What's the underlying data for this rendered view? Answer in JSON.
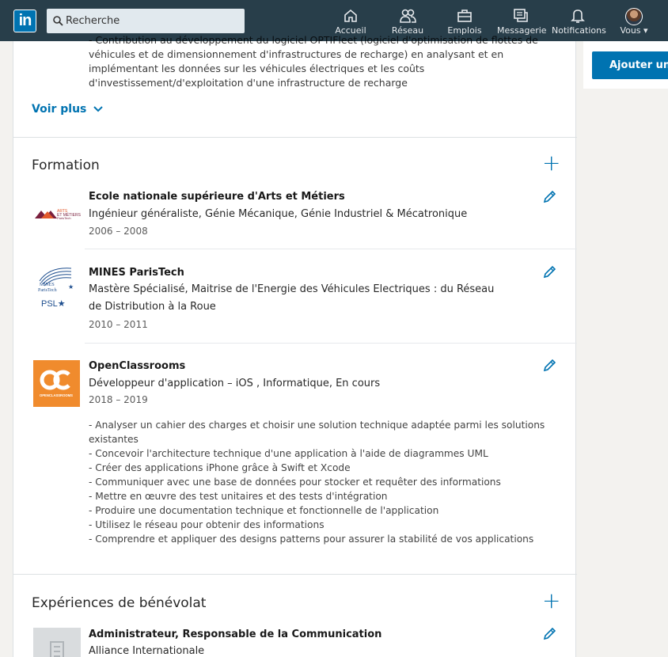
{
  "nav": {
    "search_placeholder": "Recherche",
    "items": [
      {
        "label": "Accueil",
        "icon": "home-icon"
      },
      {
        "label": "Réseau",
        "icon": "network-icon"
      },
      {
        "label": "Emplois",
        "icon": "jobs-icon"
      },
      {
        "label": "Messagerie",
        "icon": "messaging-icon"
      },
      {
        "label": "Notifications",
        "icon": "bell-icon"
      },
      {
        "label": "Vous ▾",
        "icon": "avatar"
      }
    ]
  },
  "experience_tail": {
    "lines": [
      "- Contribution au développement du logiciel OPTIFleet (logiciel d'optimisation de flottes de",
      "véhicules et de dimensionnement d'infrastructures de recharge) en analysant et en",
      "implémentant les données sur les véhicules électriques et les coûts",
      "d'investissement/d'exploitation d'une infrastructure de recharge"
    ],
    "voir_plus": "Voir plus"
  },
  "formation": {
    "title": "Formation",
    "entries": [
      {
        "school": "Ecole nationale supérieure d'Arts et Métiers",
        "degree": "Ingénieur généraliste, Génie Mécanique, Génie Industriel & Mécatronique",
        "dates": "2006 – 2008",
        "logo_text": "ARTS ET MÉTIERS ParisTech"
      },
      {
        "school": "MINES ParisTech",
        "degree": "Mastère Spécialisé, Maitrise de l'Energie des Véhicules Electriques : du Réseau de Distribution à la Roue",
        "dates": "2010 – 2011",
        "logo_text": "MINES ParisTech",
        "logo_sub": "PSL★"
      },
      {
        "school": "OpenClassrooms",
        "degree": "Développeur d'application – iOS , Informatique, En cours",
        "dates": "2018 – 2019",
        "logo_text": "OPENCLASSROOMS",
        "description": [
          "- Analyser un cahier des charges et choisir une solution technique adaptée parmi les solutions",
          "existantes",
          "- Concevoir l'architecture technique d'une application à l'aide de diagrammes UML",
          "- Créer des applications iPhone grâce à Swift et Xcode",
          "- Communiquer avec une base de données pour stocker et requêter des informations",
          "- Mettre en œuvre des test unitaires et des tests d'intégration",
          "- Produire une documentation technique et fonctionnelle de l'application",
          "- Utilisez le réseau pour obtenir des informations",
          "- Comprendre et appliquer des designs patterns pour assurer la stabilité de vos applications"
        ]
      }
    ]
  },
  "benevolat": {
    "title": "Expériences de bénévolat",
    "entries": [
      {
        "role": "Administrateur, Responsable de la Communication",
        "org": "Alliance Internationale"
      }
    ]
  },
  "right": {
    "add_button": "Ajouter une"
  },
  "colors": {
    "nav_bg": "#283e4a",
    "accent": "#0073b1",
    "openclassrooms": "#f08b2d"
  }
}
